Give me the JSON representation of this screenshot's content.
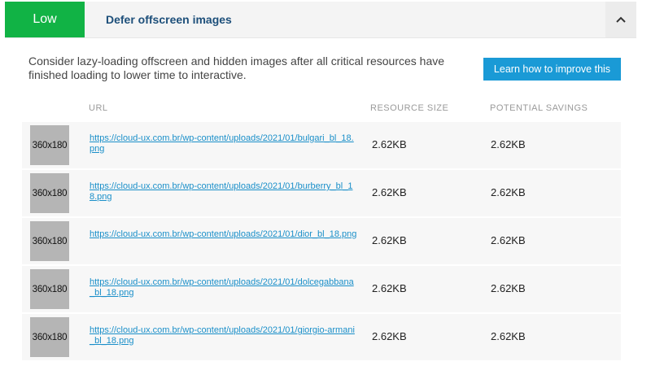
{
  "header": {
    "badge": "Low",
    "title": "Defer offscreen images",
    "toggle_icon": "chevron-up-icon"
  },
  "description": "Consider lazy-loading offscreen and hidden images after all critical resources have finished loading to lower time to interactive.",
  "learn_button": "Learn how to improve this",
  "columns": {
    "url": "URL",
    "resource_size": "RESOURCE SIZE",
    "potential_savings": "POTENTIAL SAVINGS"
  },
  "rows": [
    {
      "thumb": "360x180",
      "url": "https://cloud-ux.com.br/wp-content/uploads/2021/01/bulgari_bl_18.png",
      "size": "2.62KB",
      "savings": "2.62KB"
    },
    {
      "thumb": "360x180",
      "url": "https://cloud-ux.com.br/wp-content/uploads/2021/01/burberry_bl_18.png",
      "size": "2.62KB",
      "savings": "2.62KB"
    },
    {
      "thumb": "360x180",
      "url": "https://cloud-ux.com.br/wp-content/uploads/2021/01/dior_bl_18.png",
      "size": "2.62KB",
      "savings": "2.62KB"
    },
    {
      "thumb": "360x180",
      "url": "https://cloud-ux.com.br/wp-content/uploads/2021/01/dolcegabbana_bl_18.png",
      "size": "2.62KB",
      "savings": "2.62KB"
    },
    {
      "thumb": "360x180",
      "url": "https://cloud-ux.com.br/wp-content/uploads/2021/01/giorgio-armani_bl_18.png",
      "size": "2.62KB",
      "savings": "2.62KB"
    }
  ],
  "colors": {
    "badge": "#11b345",
    "title": "#1d4f7a",
    "button": "#1a9ad6",
    "link": "#1a8fc9"
  }
}
